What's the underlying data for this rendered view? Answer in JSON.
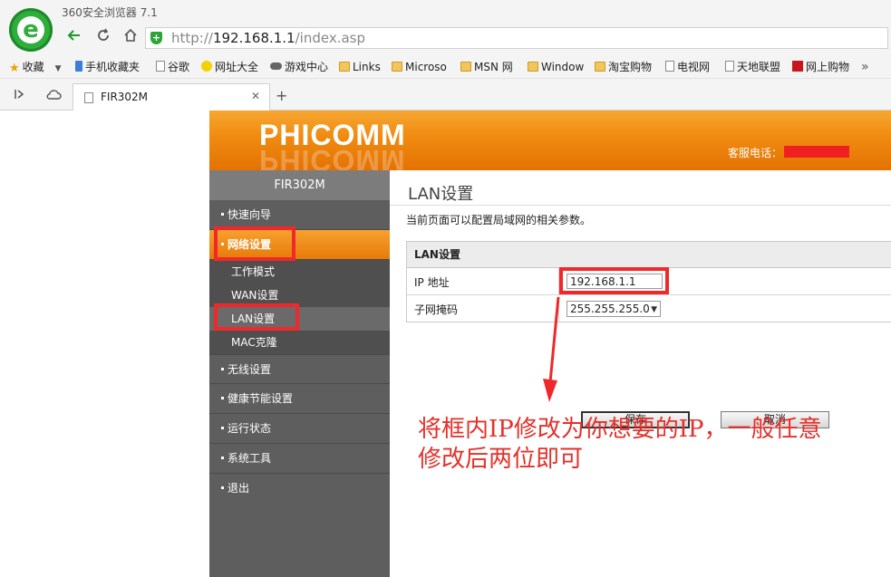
{
  "browser": {
    "app_title": "360安全浏览器 7.1",
    "url_base": "http://",
    "url_host": "192.168.1.1",
    "url_path": "/index.asp",
    "tab_title": "FIR302M",
    "tab_close": "✕",
    "new_tab": "+",
    "bookmarks": [
      {
        "label": "收藏",
        "icon": "star-icon"
      },
      {
        "label": "手机收藏夹",
        "icon": "phone-icon"
      },
      {
        "label": "谷歌",
        "icon": "page-icon"
      },
      {
        "label": "网址大全",
        "icon": "circle-icon"
      },
      {
        "label": "游戏中心",
        "icon": "gamepad-icon"
      },
      {
        "label": "Links",
        "icon": "folder-icon"
      },
      {
        "label": "Microso",
        "icon": "folder-icon"
      },
      {
        "label": "MSN 网",
        "icon": "folder-icon"
      },
      {
        "label": "Window",
        "icon": "folder-icon"
      },
      {
        "label": "淘宝购物",
        "icon": "folder-icon"
      },
      {
        "label": "电视网",
        "icon": "page-icon"
      },
      {
        "label": "天地联盟",
        "icon": "page-icon"
      },
      {
        "label": "网上购物",
        "icon": "shop-icon"
      }
    ],
    "bookmarks_more": "»",
    "accent_color": "#2fae3c"
  },
  "router": {
    "brand": "PHICOMM",
    "hotline_label": "客服电话：",
    "model": "FIR302M",
    "menu": {
      "quick_setup": "快速向导",
      "network": "网络设置",
      "work_mode": "工作模式",
      "wan": "WAN设置",
      "lan": "LAN设置",
      "mac": "MAC克隆",
      "wireless": "无线设置",
      "health": "健康节能设置",
      "status": "运行状态",
      "tools": "系统工具",
      "logout": "退出"
    },
    "page_title": "LAN设置",
    "page_desc": "当前页面可以配置局域网的相关参数。",
    "section_title": "LAN设置",
    "ip_label": "IP 地址",
    "ip_value": "192.168.1.1",
    "mask_label": "子网掩码",
    "mask_value": "255.255.255.0",
    "save": "保存",
    "cancel": "取消",
    "brand_color": "#f08a10"
  },
  "annotation": {
    "text": "将框内IP修改为你想要的IP，一般任意修改后两位即可",
    "color": "#e5302a"
  }
}
